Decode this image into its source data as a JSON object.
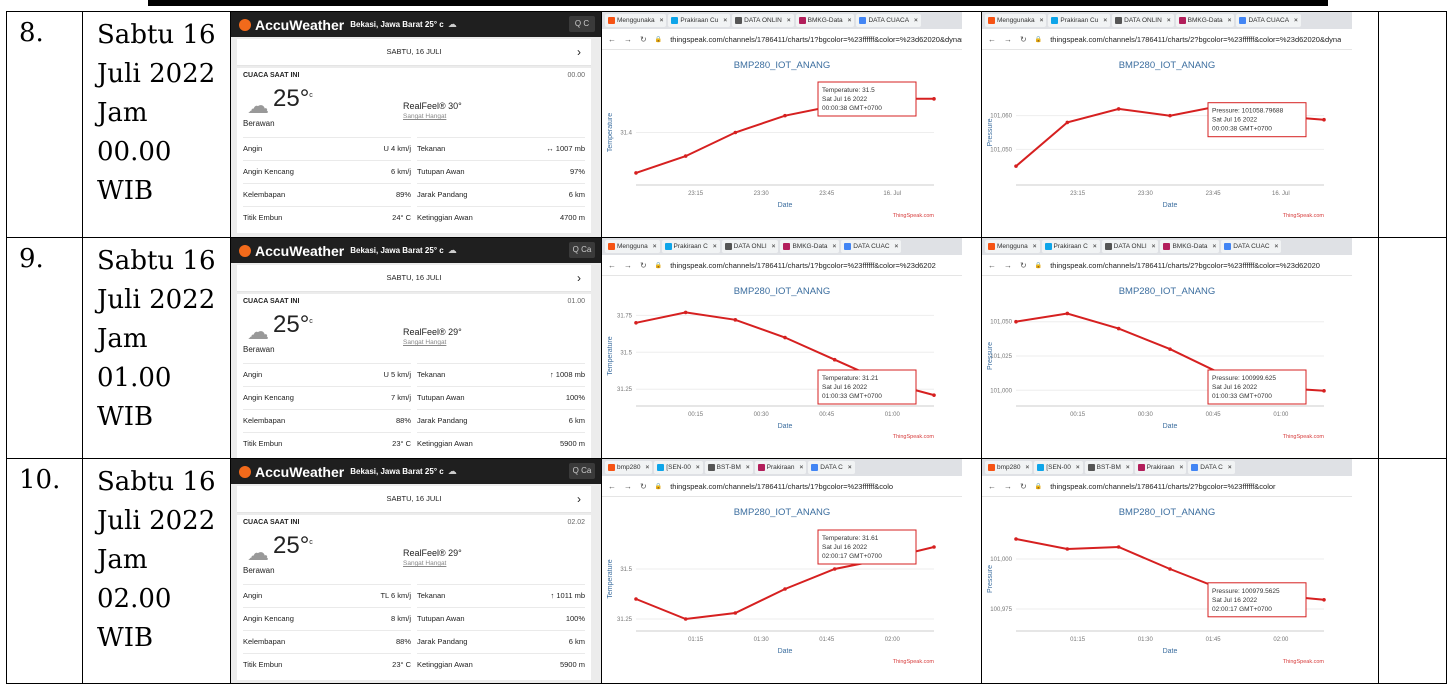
{
  "rows": [
    {
      "no": "8.",
      "date_lines": [
        "Sabtu 16",
        "Juli 2022",
        "Jam",
        "00.00",
        "WIB"
      ],
      "weather": {
        "brand": "AccuWeather",
        "location": "Bekasi, Jawa Barat 25° c",
        "search": "Q C",
        "date": "SABTU, 16 JULI",
        "card_title": "CUACA SAAT INI",
        "time": "00.00",
        "temp": "25°",
        "unit": "c",
        "condition": "Berawan",
        "realfeel": "RealFeel® 30°",
        "realfeel_note": "Sangat Hangat",
        "left": [
          {
            "label": "Angin",
            "value": "U 4 km/j"
          },
          {
            "label": "Angin Kencang",
            "value": "6 km/j"
          },
          {
            "label": "Kelembapan",
            "value": "89%"
          },
          {
            "label": "Titik Embun",
            "value": "24° C"
          }
        ],
        "right": [
          {
            "label": "Tekanan",
            "value": "↔ 1007 mb"
          },
          {
            "label": "Tutupan Awan",
            "value": "97%"
          },
          {
            "label": "Jarak Pandang",
            "value": "6 km"
          },
          {
            "label": "Ketinggian Awan",
            "value": "4700 m"
          }
        ]
      },
      "browser_tabs": [
        "Menggunaka",
        "Prakiraan Cu",
        "DATA ONLIN",
        "BMKG-Data",
        "DATA CUACA"
      ],
      "temp_chart": {
        "url": "thingspeak.com/channels/1786411/charts/1?bgcolor=%23ffffff&color=%23d62020&dynan",
        "title": "BMP280_IOT_ANANG",
        "ylabel": "Temperature",
        "xlabel": "Date",
        "yticks": [
          "31.4"
        ],
        "xticks": [
          "23:15",
          "23:30",
          "23:45",
          "16. Jul"
        ],
        "tooltip": [
          "Temperature: 31.5",
          "Sat Jul 16 2022",
          "00:00:38 GMT+0700"
        ],
        "credit": "ThingSpeak.com",
        "ylim": [
          31.25,
          31.55
        ]
      },
      "press_chart": {
        "url": "thingspeak.com/channels/1786411/charts/2?bgcolor=%23ffffff&color=%23d62020&dyna",
        "title": "BMP280_IOT_ANANG",
        "ylabel": "Pressure",
        "xlabel": "Date",
        "yticks": [
          "101,060",
          "101,050"
        ],
        "xticks": [
          "23:15",
          "23:30",
          "23:45",
          "16. Jul"
        ],
        "tooltip": [
          "Pressure: 101058.79688",
          "Sat Jul 16 2022",
          "00:00:38 GMT+0700"
        ],
        "credit": "ThingSpeak.com",
        "ylim": [
          101040,
          101070
        ]
      }
    },
    {
      "no": "9.",
      "date_lines": [
        "Sabtu 16",
        "Juli 2022",
        "Jam",
        "01.00",
        "WIB"
      ],
      "weather": {
        "brand": "AccuWeather",
        "location": "Bekasi, Jawa Barat 25° c",
        "search": "Q Ca",
        "date": "SABTU, 16 JULI",
        "card_title": "CUACA SAAT INI",
        "time": "01.00",
        "temp": "25°",
        "unit": "c",
        "condition": "Berawan",
        "realfeel": "RealFeel® 29°",
        "realfeel_note": "Sangat Hangat",
        "left": [
          {
            "label": "Angin",
            "value": "U 5 km/j"
          },
          {
            "label": "Angin Kencang",
            "value": "7 km/j"
          },
          {
            "label": "Kelembapan",
            "value": "88%"
          },
          {
            "label": "Titik Embun",
            "value": "23° C"
          }
        ],
        "right": [
          {
            "label": "Tekanan",
            "value": "↑ 1008 mb"
          },
          {
            "label": "Tutupan Awan",
            "value": "100%"
          },
          {
            "label": "Jarak Pandang",
            "value": "6 km"
          },
          {
            "label": "Ketinggian Awan",
            "value": "5900 m"
          }
        ]
      },
      "browser_tabs": [
        "Mengguna",
        "Prakiraan C",
        "DATA ONLI",
        "BMKG-Data",
        "DATA CUAC"
      ],
      "temp_chart": {
        "url": "thingspeak.com/channels/1786411/charts/1?bgcolor=%23ffffff&color=%23d6202",
        "title": "BMP280_IOT_ANANG",
        "ylabel": "Temperature",
        "xlabel": "Date",
        "yticks": [
          "31.75",
          "31.5",
          "31.25"
        ],
        "xticks": [
          "00:15",
          "00:30",
          "00:45",
          "01:00"
        ],
        "tooltip": [
          "Temperature: 31.21",
          "Sat Jul 16 2022",
          "01:00:33 GMT+0700"
        ],
        "credit": "ThingSpeak.com",
        "ylim": [
          31.15,
          31.8
        ]
      },
      "press_chart": {
        "url": "thingspeak.com/channels/1786411/charts/2?bgcolor=%23ffffff&color=%23d62020",
        "title": "BMP280_IOT_ANANG",
        "ylabel": "Pressure",
        "xlabel": "Date",
        "yticks": [
          "101,050",
          "101,025",
          "101,000"
        ],
        "xticks": [
          "00:15",
          "00:30",
          "00:45",
          "01:00"
        ],
        "tooltip": [
          "Pressure: 100999.625",
          "Sat Jul 16 2022",
          "01:00:33 GMT+0700"
        ],
        "credit": "ThingSpeak.com",
        "ylim": [
          100990,
          101060
        ]
      }
    },
    {
      "no": "10.",
      "date_lines": [
        "Sabtu 16",
        "Juli 2022",
        "Jam",
        "02.00",
        "WIB"
      ],
      "weather": {
        "brand": "AccuWeather",
        "location": "Bekasi, Jawa Barat 25° c",
        "search": "Q Ca",
        "date": "SABTU, 16 JULI",
        "card_title": "CUACA SAAT INI",
        "time": "02.02",
        "temp": "25°",
        "unit": "c",
        "condition": "Berawan",
        "realfeel": "RealFeel® 29°",
        "realfeel_note": "Sangat Hangat",
        "left": [
          {
            "label": "Angin",
            "value": "TL 6 km/j"
          },
          {
            "label": "Angin Kencang",
            "value": "8 km/j"
          },
          {
            "label": "Kelembapan",
            "value": "88%"
          },
          {
            "label": "Titik Embun",
            "value": "23° C"
          }
        ],
        "right": [
          {
            "label": "Tekanan",
            "value": "↑ 1011 mb"
          },
          {
            "label": "Tutupan Awan",
            "value": "100%"
          },
          {
            "label": "Jarak Pandang",
            "value": "6 km"
          },
          {
            "label": "Ketinggian Awan",
            "value": "5900 m"
          }
        ]
      },
      "browser_tabs": [
        "bmp280",
        "[SEN-00",
        "BST-BM",
        "Prakiraan",
        "DATA C"
      ],
      "temp_chart": {
        "url": "thingspeak.com/channels/1786411/charts/1?bgcolor=%23ffffff&colo",
        "title": "BMP280_IOT_ANANG",
        "ylabel": "Temperature",
        "xlabel": "Date",
        "yticks": [
          "31.5",
          "31.25"
        ],
        "xticks": [
          "01:15",
          "01:30",
          "01:45",
          "02:00"
        ],
        "tooltip": [
          "Temperature: 31.61",
          "Sat Jul 16 2022",
          "02:00:17 GMT+0700"
        ],
        "credit": "ThingSpeak.com",
        "ylim": [
          31.2,
          31.7
        ]
      },
      "press_chart": {
        "url": "thingspeak.com/channels/1786411/charts/2?bgcolor=%23ffffff&color",
        "title": "BMP280_IOT_ANANG",
        "ylabel": "Pressure",
        "xlabel": "Date",
        "yticks": [
          "101,000",
          "100,975"
        ],
        "xticks": [
          "01:15",
          "01:30",
          "01:45",
          "02:00"
        ],
        "tooltip": [
          "Pressure: 100979.5625",
          "Sat Jul 16 2022",
          "02:00:17 GMT+0700"
        ],
        "credit": "ThingSpeak.com",
        "ylim": [
          100965,
          101015
        ]
      }
    }
  ],
  "chart_data": [
    {
      "type": "line",
      "title": "BMP280_IOT_ANANG",
      "xlabel": "Date",
      "ylabel": "Temperature",
      "x": [
        "23:05",
        "23:15",
        "23:25",
        "23:35",
        "23:45",
        "23:55",
        "00:00"
      ],
      "values": [
        31.28,
        31.33,
        31.4,
        31.45,
        31.48,
        31.5,
        31.5
      ]
    },
    {
      "type": "line",
      "title": "BMP280_IOT_ANANG",
      "xlabel": "Date",
      "ylabel": "Pressure",
      "x": [
        "23:05",
        "23:15",
        "23:25",
        "23:35",
        "23:45",
        "23:55",
        "00:00"
      ],
      "values": [
        101045,
        101058,
        101062,
        101060,
        101063,
        101060,
        101058.8
      ]
    },
    {
      "type": "line",
      "title": "BMP280_IOT_ANANG",
      "xlabel": "Date",
      "ylabel": "Temperature",
      "x": [
        "00:05",
        "00:15",
        "00:25",
        "00:35",
        "00:45",
        "00:55",
        "01:00"
      ],
      "values": [
        31.7,
        31.77,
        31.72,
        31.6,
        31.45,
        31.3,
        31.21
      ]
    },
    {
      "type": "line",
      "title": "BMP280_IOT_ANANG",
      "xlabel": "Date",
      "ylabel": "Pressure",
      "x": [
        "00:05",
        "00:15",
        "00:25",
        "00:35",
        "00:45",
        "00:55",
        "01:00"
      ],
      "values": [
        101050,
        101056,
        101045,
        101030,
        101012,
        101002,
        100999.6
      ]
    },
    {
      "type": "line",
      "title": "BMP280_IOT_ANANG",
      "xlabel": "Date",
      "ylabel": "Temperature",
      "x": [
        "01:05",
        "01:15",
        "01:25",
        "01:35",
        "01:45",
        "01:55",
        "02:00"
      ],
      "values": [
        31.35,
        31.25,
        31.28,
        31.4,
        31.5,
        31.55,
        31.61
      ]
    },
    {
      "type": "line",
      "title": "BMP280_IOT_ANANG",
      "xlabel": "Date",
      "ylabel": "Pressure",
      "x": [
        "01:05",
        "01:15",
        "01:25",
        "01:35",
        "01:45",
        "01:55",
        "02:00"
      ],
      "values": [
        101010,
        101005,
        101006,
        100995,
        100985,
        100982,
        100979.6
      ]
    }
  ]
}
